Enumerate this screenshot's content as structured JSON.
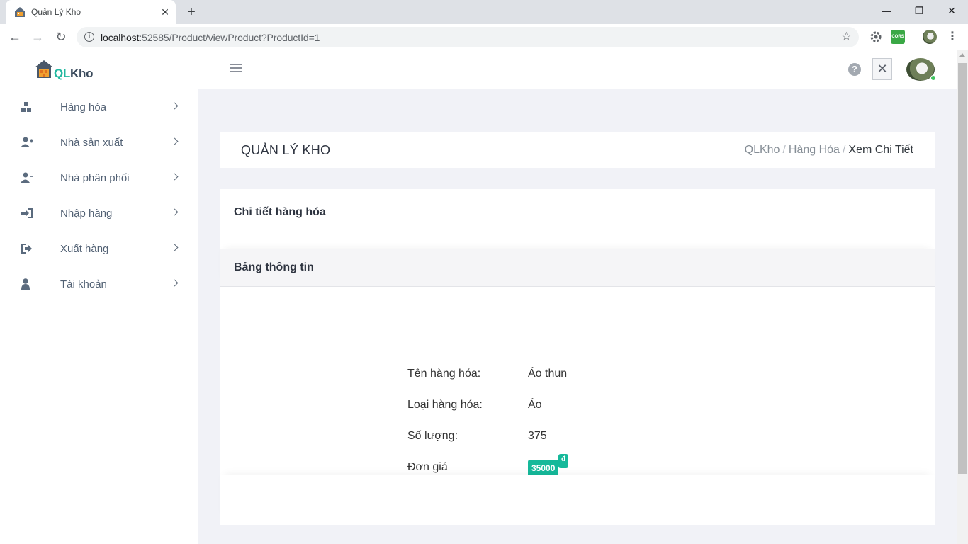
{
  "browser": {
    "tab_title": "Quản Lý Kho",
    "tab_close": "✕",
    "new_tab": "+",
    "url_host": "localhost",
    "url_rest": ":52585/Product/viewProduct?ProductId=1",
    "win_minimize": "—",
    "win_restore": "❐",
    "win_close": "✕",
    "ext_cors_label": "CORS"
  },
  "app": {
    "logo_ql": "QL",
    "logo_kho": "Kho",
    "help_glyph": "?",
    "close_glyph": "✕"
  },
  "sidebar": {
    "items": [
      {
        "label": "Hàng hóa",
        "icon": "boxes-icon"
      },
      {
        "label": "Nhà sản xuất",
        "icon": "user-plus-icon"
      },
      {
        "label": "Nhà phân phối",
        "icon": "user-minus-icon"
      },
      {
        "label": "Nhập hàng",
        "icon": "sign-in-icon"
      },
      {
        "label": "Xuất hàng",
        "icon": "sign-out-icon"
      },
      {
        "label": "Tài khoản",
        "icon": "user-icon"
      }
    ]
  },
  "header": {
    "title": "QUẢN LÝ KHO",
    "breadcrumb": [
      "QLKho",
      "Hàng Hóa",
      "Xem Chi Tiết"
    ],
    "sep": "/"
  },
  "card": {
    "title": "Chi tiết hàng hóa",
    "section_title": "Bảng thông tin",
    "fields": [
      {
        "label": "Tên hàng hóa:",
        "value": "Áo thun"
      },
      {
        "label": "Loại hàng hóa:",
        "value": "Áo"
      },
      {
        "label": "Số lượng:",
        "value": "375"
      },
      {
        "label": "Đơn giá",
        "value": "35000",
        "unit": "đ"
      }
    ]
  },
  "colors": {
    "accent": "#15b99a",
    "sidebar_text": "#526174",
    "page_bg": "#f1f2f7"
  }
}
